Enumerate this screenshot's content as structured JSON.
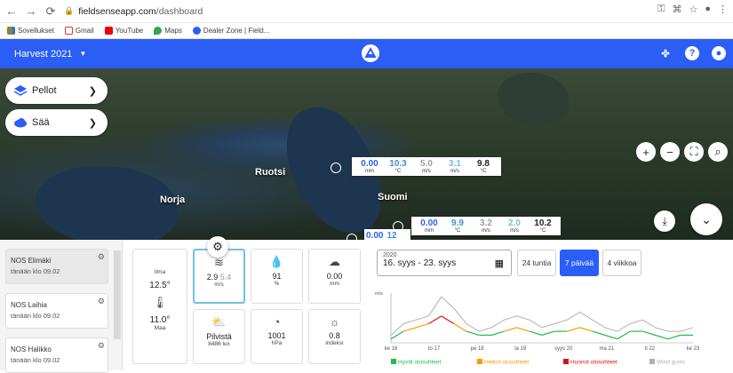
{
  "browser": {
    "url_host": "fieldsenseapp.com",
    "url_path": "/dashboard",
    "bookmarks": [
      "Sovellukset",
      "Gmail",
      "YouTube",
      "Maps",
      "Dealer Zone | Field..."
    ]
  },
  "app": {
    "season": "Harvest 2021"
  },
  "map": {
    "pill_fields": "Pellot",
    "pill_weather": "Sää",
    "countries": {
      "sweden": "Ruotsi",
      "finland": "Suomi",
      "norway": "Norja"
    },
    "box1": [
      {
        "v": "0.00",
        "u": "mm",
        "c": "#2b5ef7"
      },
      {
        "v": "10.3",
        "u": "°C",
        "c": "#3b8fd9"
      },
      {
        "v": "5.0",
        "u": "m/s",
        "c": "#9e9e9e"
      },
      {
        "v": "3.1",
        "u": "m/s",
        "c": "#6ec0e6"
      },
      {
        "v": "9.8",
        "u": "°C",
        "c": "#222222"
      }
    ],
    "box2": [
      {
        "v": "0.00",
        "u": "mm",
        "c": "#2b5ef7"
      },
      {
        "v": "9.9",
        "u": "°C",
        "c": "#3b8fd9"
      },
      {
        "v": "3.2",
        "u": "m/s",
        "c": "#9e9e9e"
      },
      {
        "v": "2.0",
        "u": "m/s",
        "c": "#6ec0e6"
      },
      {
        "v": "10.2",
        "u": "°C",
        "c": "#222222"
      }
    ],
    "box3_partial": "0.00",
    "box3_partial_2": "12"
  },
  "stations": [
    {
      "name": "NOS Elimäki",
      "time": "tänään klo 09.02"
    },
    {
      "name": "NOS Laihia",
      "time": "tänään klo 09.02"
    },
    {
      "name": "NOS Halikko",
      "time": "tänään klo 09.02"
    }
  ],
  "tiles": {
    "air_label": "Ilma",
    "air_temp": "12.5°",
    "ground_temp": "11.0°",
    "ground_label": "Maa",
    "wind": "2.9",
    "gust": "5.4",
    "wind_unit": "m/s",
    "humidity": "91",
    "humidity_unit": "%",
    "rain": "0.00",
    "rain_unit": "mm",
    "sky": "Pilvistä",
    "lux": "8486 lux",
    "pressure": "1001",
    "pressure_unit": "hPa",
    "uv": "0.8",
    "uv_unit": "indeksi"
  },
  "range": {
    "year": "2020",
    "dates": "16. syys - 23. syys",
    "opt_24h": "24 tuntia",
    "opt_7d": "7 päivää",
    "opt_4w": "4 viikkoa"
  },
  "chart_data": {
    "type": "line",
    "ylabel": "m/s",
    "x": [
      "ke 16",
      "to 17",
      "pe 18",
      "la 19",
      "syys 20",
      "ma 21",
      "ti 22",
      "ke 23"
    ],
    "legend": [
      {
        "name": "Hyvät olosuhteet",
        "color": "#22bb44"
      },
      {
        "name": "Heikot olosuhteet",
        "color": "#ff9900"
      },
      {
        "name": "Huonot olosuhteet",
        "color": "#dd1111"
      },
      {
        "name": "Wind gusts",
        "color": "#b0b0b0"
      }
    ],
    "series": [
      {
        "name": "Wind gusts",
        "values": [
          2,
          5,
          6,
          7,
          12,
          9,
          5,
          3,
          4,
          6,
          7,
          6,
          4,
          5,
          6,
          8,
          6,
          4,
          3,
          5,
          6,
          4,
          3,
          3,
          4
        ]
      },
      {
        "name": "Wind",
        "values": [
          1,
          3,
          4,
          5,
          7,
          5,
          3,
          2,
          2,
          3,
          4,
          3,
          2,
          3,
          3,
          4,
          3,
          2,
          1,
          3,
          3,
          2,
          1,
          2,
          2
        ]
      }
    ]
  }
}
